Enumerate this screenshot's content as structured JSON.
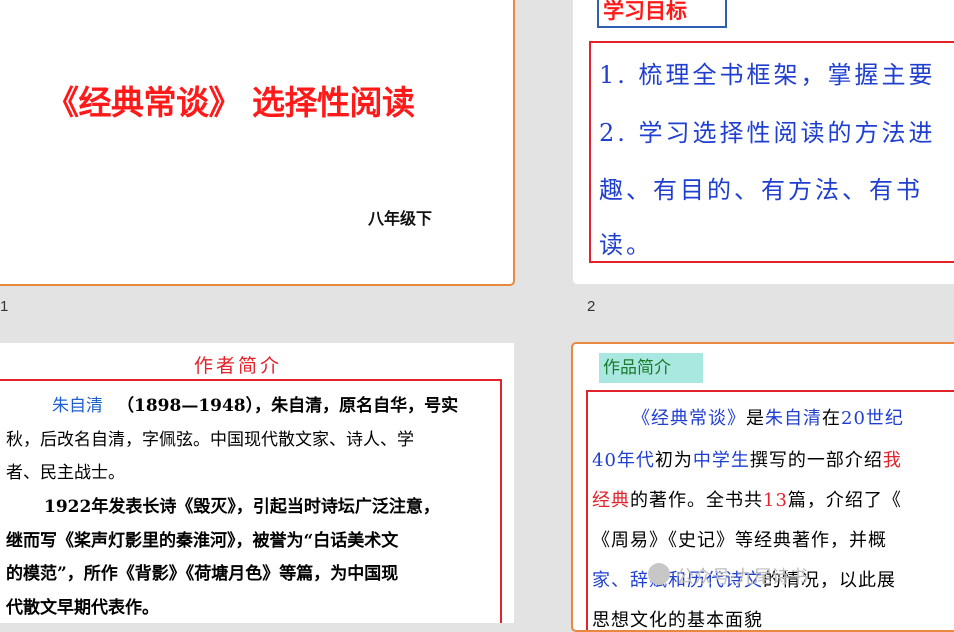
{
  "slides": [
    {
      "number": "1",
      "title": "《经典常谈》  选择性阅读",
      "subtitle": "八年级下"
    },
    {
      "number": "2",
      "tag": "学习目标",
      "lines": [
        "1. 梳理全书框架，掌握主要",
        "2. 学习选择性阅读的方法进",
        "趣、有目的、有方法、有书",
        "读。"
      ]
    },
    {
      "heading": "作者简介",
      "p1_name": "朱自清",
      "p1_lines": [
        "（1898—1948），朱自清，原名自华，号实",
        "秋，后改名自清，字佩弦。中国现代散文家、诗人、学",
        "者、民主战士。"
      ],
      "p2_lines": [
        "1922年发表长诗《毁灭》，引起当时诗坛广泛注意，",
        "继而写《桨声灯影里的秦淮河》，被誉为“白话美术文",
        "的模范”，所作《背影》《荷塘月色》等篇，为中国现",
        "代散文早期代表作。"
      ]
    },
    {
      "tag": "作品简介",
      "l1": [
        "《经典常谈》",
        "是",
        "朱自清",
        "在",
        "20世纪"
      ],
      "l2": [
        "40年代",
        "初为",
        "中学生",
        "撰写的一部介绍",
        "我"
      ],
      "l3": [
        "经典",
        "的著作。全书共",
        "13",
        "篇，介绍了《"
      ],
      "l4": "《周易》《史记》等经典著作，并概",
      "l5": [
        "家、辞赋和历代诗文",
        "的情况，以此展"
      ],
      "l6": "思想文化的基本面貌"
    }
  ],
  "watermark": "公众号·九尾诗书"
}
